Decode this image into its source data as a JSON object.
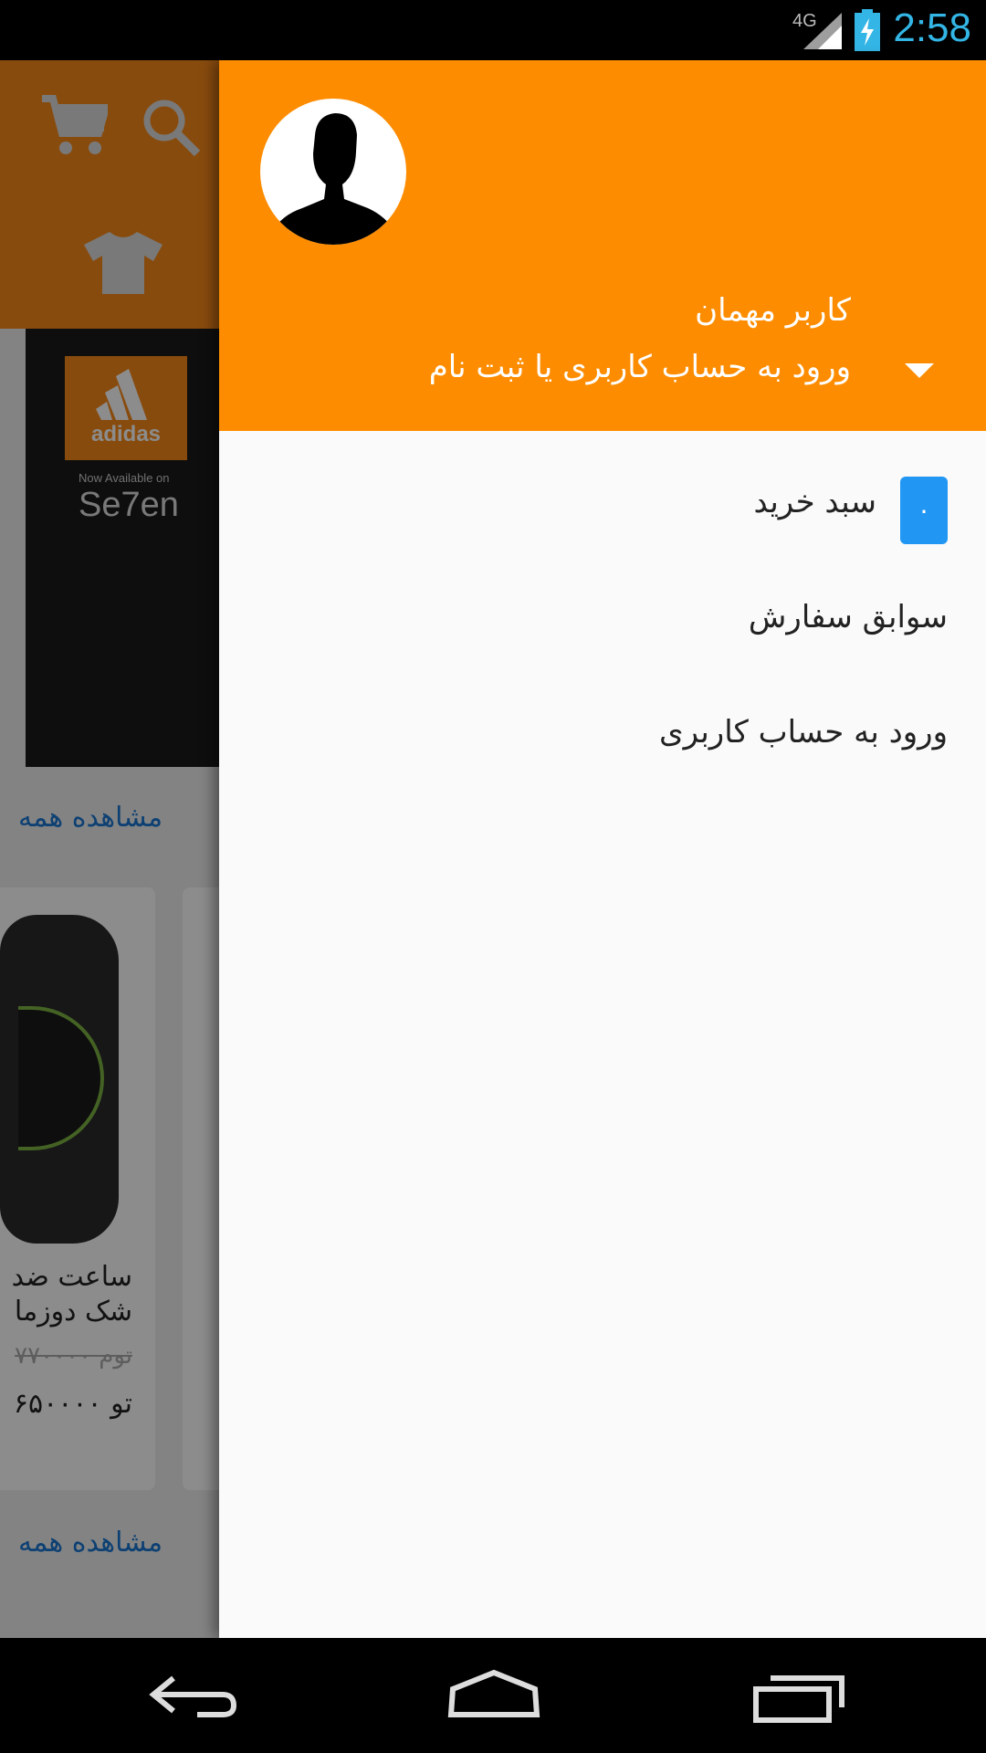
{
  "status_bar": {
    "network": "4G",
    "time": "2:58"
  },
  "background_app": {
    "see_all_1": "مشاهده همه",
    "see_all_2": "مشاهده همه",
    "banner": {
      "brand": "adidas",
      "available": "Now Available on",
      "store": "Se7en"
    },
    "product": {
      "title_line1": "ساعت ضد",
      "title_line2": "شک دوزما",
      "old_price": "۷۷۰۰۰۰ توم",
      "new_price": "۶۵۰۰۰۰ تو"
    },
    "icons": [
      "cart-icon",
      "search-icon",
      "tshirt-icon"
    ]
  },
  "drawer": {
    "header": {
      "user_name": "کاربر مهمان",
      "account_prompt": "ورود به حساب کاربری یا ثبت نام"
    },
    "menu": [
      {
        "label": "سبد خرید",
        "badge": "۰"
      },
      {
        "label": "سوابق سفارش"
      },
      {
        "label": "ورود به حساب کاربری"
      }
    ]
  },
  "colors": {
    "accent": "#fd8c00",
    "badge": "#2196f3",
    "link": "#1976d2",
    "time": "#33b5e5"
  }
}
